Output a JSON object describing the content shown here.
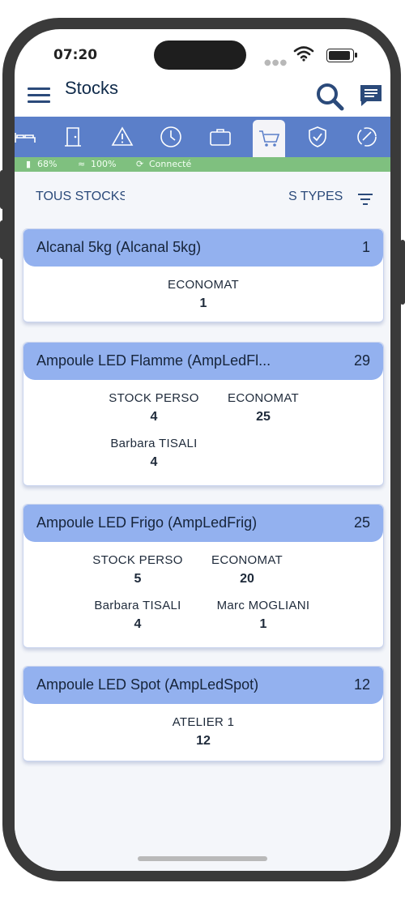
{
  "status_bar": {
    "time": "07:20",
    "dots": "●●●"
  },
  "header": {
    "title": "Stocks"
  },
  "tabs": [
    {
      "icon": "bed-icon"
    },
    {
      "icon": "door-icon"
    },
    {
      "icon": "warning-icon"
    },
    {
      "icon": "clock-icon"
    },
    {
      "icon": "briefcase-icon"
    },
    {
      "icon": "cart-icon",
      "active": true
    },
    {
      "icon": "shield-check-icon"
    },
    {
      "icon": "sync-icon"
    }
  ],
  "info_bar": {
    "battery": "68%",
    "wifi": "100%",
    "connection": "Connecté"
  },
  "filters": {
    "left": "TOUS STOCKS",
    "right": "S TYPES"
  },
  "products": [
    {
      "title": "Alcanal 5kg (Alcanal 5kg)",
      "count": "1",
      "locations": [
        {
          "name": "ECONOMAT",
          "qty": "1"
        }
      ]
    },
    {
      "title": "Ampoule LED Flamme (AmpLedFl...",
      "count": "29",
      "locations": [
        {
          "name": "STOCK PERSO",
          "qty": "4"
        },
        {
          "name": "ECONOMAT",
          "qty": "25"
        },
        {
          "name": "Barbara TISALI",
          "qty": "4"
        }
      ]
    },
    {
      "title": "Ampoule LED Frigo (AmpLedFrig)",
      "count": "25",
      "locations": [
        {
          "name": "STOCK PERSO",
          "qty": "5"
        },
        {
          "name": "ECONOMAT",
          "qty": "20"
        },
        {
          "name": "Barbara TISALI",
          "qty": "4"
        },
        {
          "name": "Marc MOGLIANI",
          "qty": "1"
        }
      ]
    },
    {
      "title": "Ampoule LED Spot (AmpLedSpot)",
      "count": "12",
      "locations": [
        {
          "name": "ATELIER 1",
          "qty": "12"
        }
      ]
    }
  ],
  "colors": {
    "tabbar": "#5b7fc9",
    "card_header": "#93b1ef",
    "info_bar": "#7fc07f",
    "title": "#0f2a4a"
  }
}
